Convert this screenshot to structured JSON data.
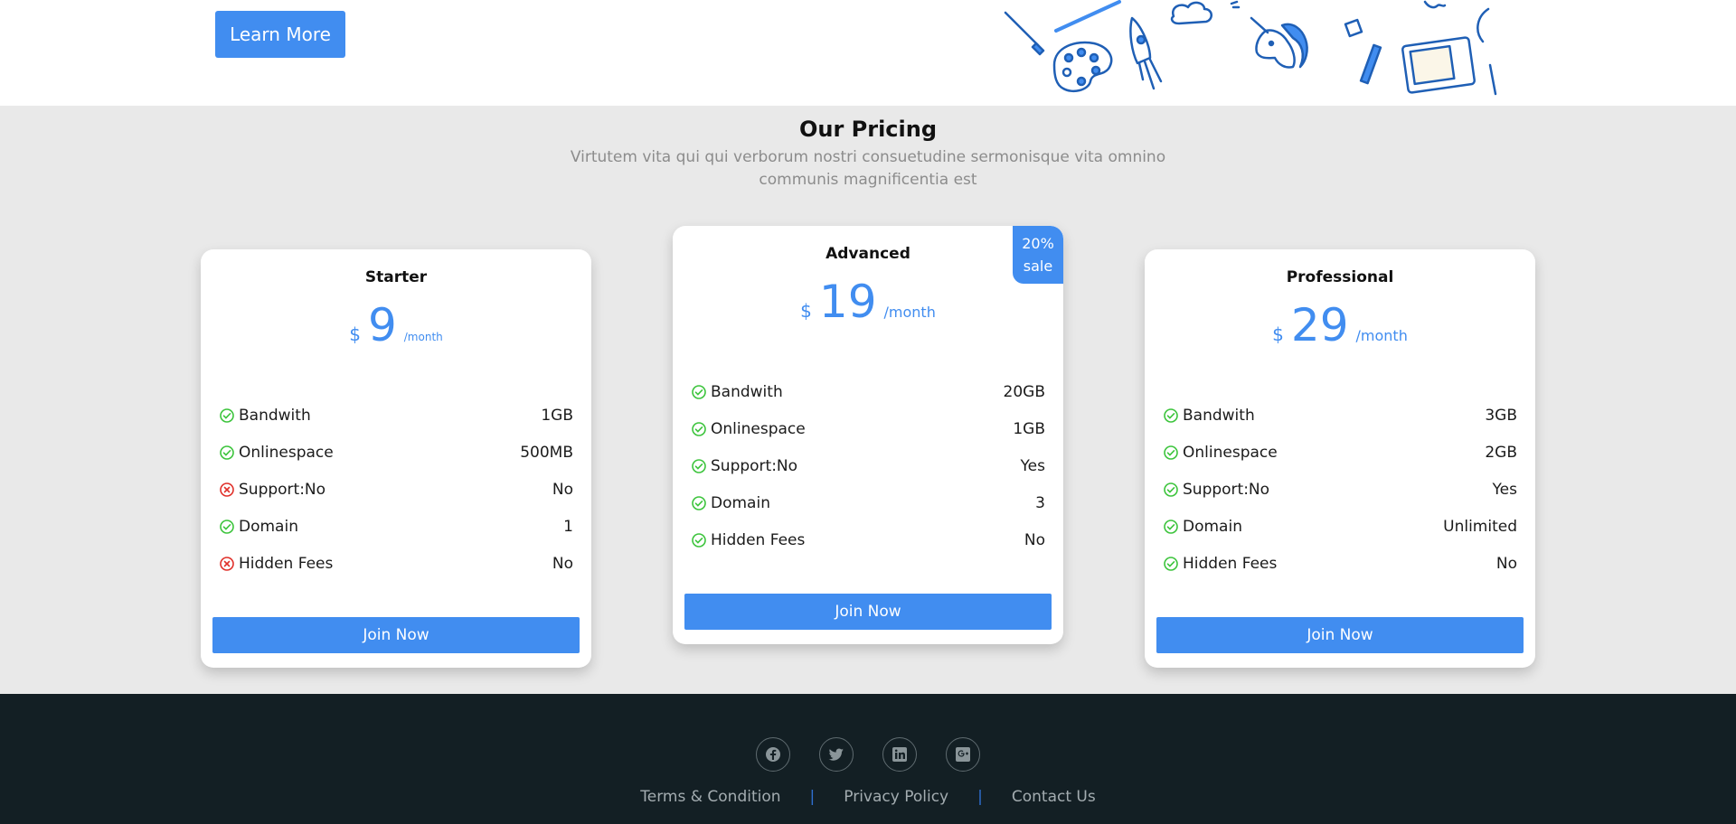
{
  "hero": {
    "learn_more_label": "Learn More"
  },
  "pricing": {
    "title": "Our Pricing",
    "subtitle": "Virtutem vita qui qui verborum nostri consuetudine sermonisque vita omnino communis magnificentia est",
    "plans": [
      {
        "name": "Starter",
        "currency": "$",
        "amount": "9",
        "period": "/month",
        "features": [
          {
            "label": "Bandwith",
            "value": "1GB",
            "included": true
          },
          {
            "label": "Onlinespace",
            "value": "500MB",
            "included": true
          },
          {
            "label": "Support:No",
            "value": "No",
            "included": false
          },
          {
            "label": "Domain",
            "value": "1",
            "included": true
          },
          {
            "label": "Hidden Fees",
            "value": "No",
            "included": false
          }
        ],
        "cta": "Join Now"
      },
      {
        "name": "Advanced",
        "currency": "$",
        "amount": "19",
        "period": "/month",
        "badge": [
          "20%",
          "sale"
        ],
        "features": [
          {
            "label": "Bandwith",
            "value": "20GB",
            "included": true
          },
          {
            "label": "Onlinespace",
            "value": "1GB",
            "included": true
          },
          {
            "label": "Support:No",
            "value": "Yes",
            "included": true
          },
          {
            "label": "Domain",
            "value": "3",
            "included": true
          },
          {
            "label": "Hidden Fees",
            "value": "No",
            "included": true
          }
        ],
        "cta": "Join Now"
      },
      {
        "name": "Professional",
        "currency": "$",
        "amount": "29",
        "period": "/month",
        "features": [
          {
            "label": "Bandwith",
            "value": "3GB",
            "included": true
          },
          {
            "label": "Onlinespace",
            "value": "2GB",
            "included": true
          },
          {
            "label": "Support:No",
            "value": "Yes",
            "included": true
          },
          {
            "label": "Domain",
            "value": "Unlimited",
            "included": true
          },
          {
            "label": "Hidden Fees",
            "value": "No",
            "included": true
          }
        ],
        "cta": "Join Now"
      }
    ]
  },
  "footer": {
    "social": [
      {
        "icon": "facebook-icon"
      },
      {
        "icon": "twitter-icon"
      },
      {
        "icon": "linkedin-icon"
      },
      {
        "icon": "google-plus-icon"
      }
    ],
    "links": [
      "Terms & Condition",
      "Privacy Policy",
      "Contact Us"
    ]
  },
  "colors": {
    "accent": "#418df0",
    "check": "#3cc43c",
    "cross": "#e0302a",
    "footer_bg": "#131f24",
    "section_bg": "#e9e9e9"
  }
}
